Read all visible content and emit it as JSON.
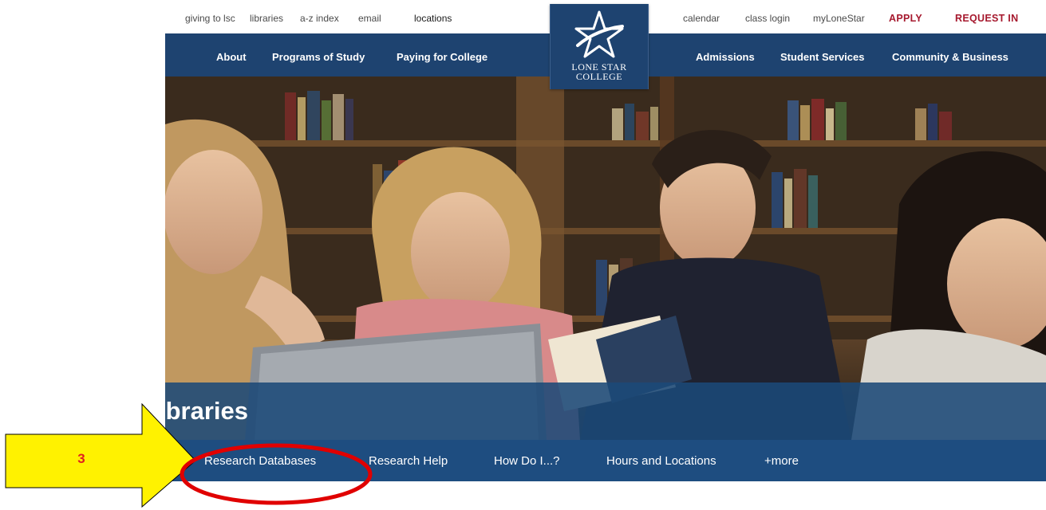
{
  "util_nav": {
    "left": [
      "giving to lsc",
      "libraries",
      "a-z index",
      "email",
      "locations"
    ],
    "right": [
      "calendar",
      "class login",
      "myLoneStar"
    ],
    "apply": "APPLY",
    "request": "REQUEST IN"
  },
  "main_nav": {
    "left": [
      "About",
      "Programs of Study",
      "Paying for College"
    ],
    "right": [
      "Admissions",
      "Student Services",
      "Community & Business"
    ]
  },
  "logo": {
    "line1": "LONE STAR",
    "line2": "COLLEGE"
  },
  "page_title": "ibraries",
  "sub_nav": [
    "Research Databases",
    "Research Help",
    "How Do I...?",
    "Hours and Locations",
    "+more"
  ],
  "annotation": {
    "step": "3",
    "arrow_color": "#fff200",
    "circle_color": "#e00000"
  },
  "colors": {
    "nav_blue": "#1e4370",
    "subnav_blue": "#1e4d80",
    "accent_red": "#a6192e"
  }
}
